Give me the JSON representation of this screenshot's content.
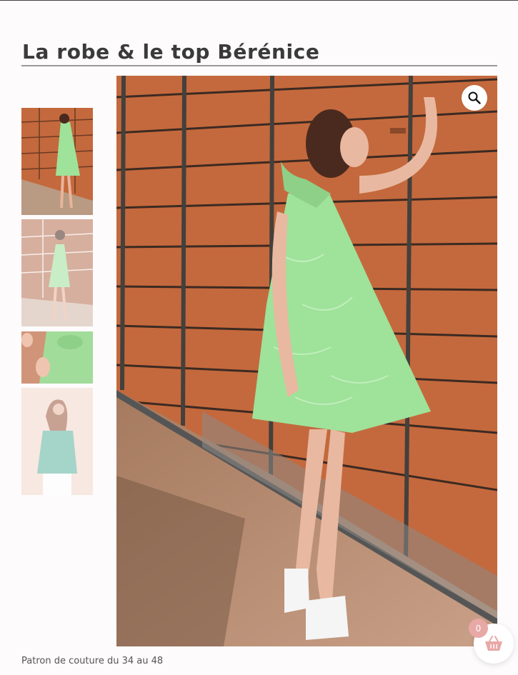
{
  "product": {
    "title": "La robe & le top Bérénice",
    "subtitle": "Patron de couture du 34 au 48"
  },
  "gallery": {
    "thumbnails": [
      {
        "alt": "thumbnail-1"
      },
      {
        "alt": "thumbnail-2"
      },
      {
        "alt": "thumbnail-3"
      },
      {
        "alt": "thumbnail-4"
      }
    ],
    "zoom_icon": "magnifier-icon"
  },
  "cart": {
    "count": "0",
    "icon": "basket-icon"
  },
  "colors": {
    "wall": "#c4693d",
    "dress": "#9fe29a",
    "badge": "#e8a8a6"
  }
}
